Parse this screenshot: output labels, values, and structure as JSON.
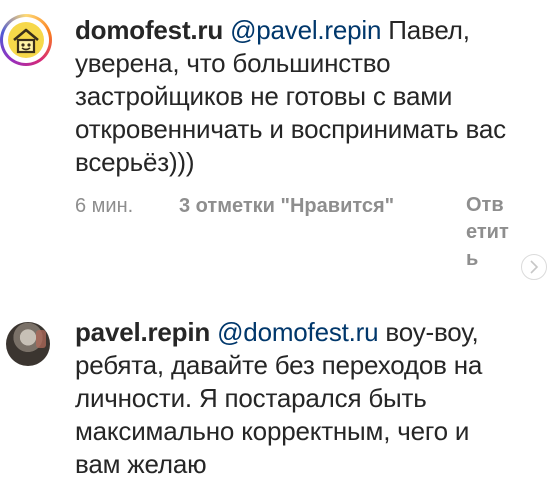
{
  "comments": [
    {
      "username": "domofest.ru",
      "mention": "@pavel.repin",
      "text": " Павел, уверена, что большинство застройщиков не готовы с вами откровенничать и воспринимать вас всерьёз)))",
      "time": "6 мин.",
      "likes": "3 отметки \"Нравится\"",
      "reply": "Ответить"
    },
    {
      "username": "pavel.repin",
      "mention": "@domofest.ru",
      "text": " воу-воу, ребята, давайте без переходов на личности. Я постарался быть максимально корректным, чего и вам желаю"
    }
  ],
  "icons": {
    "avatar_1": "house-logo-avatar",
    "avatar_2": "profile-photo-avatar",
    "expand": "chevron-right-icon"
  }
}
